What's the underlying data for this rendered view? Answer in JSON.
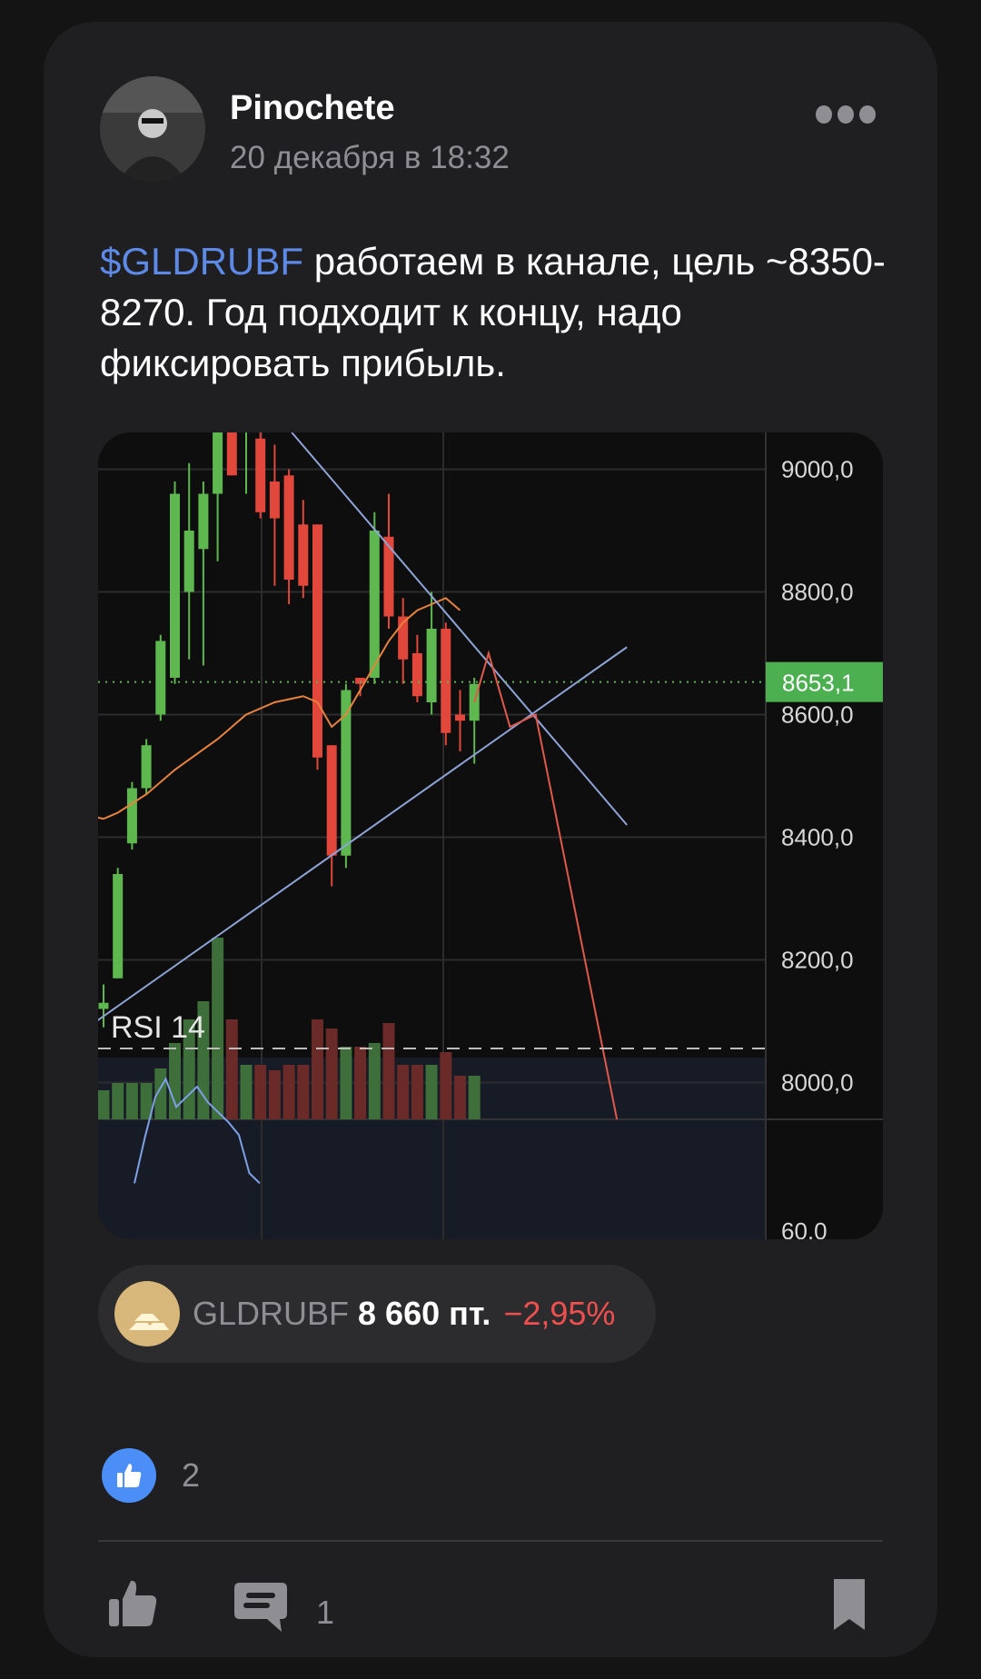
{
  "post": {
    "author": "Pinochete",
    "date": "20 декабря в 18:32",
    "ticker_link": "$GLDRUBF",
    "text": " работаем в канале, цель ~8350-8270. Год подходит к концу, надо фиксировать прибыль."
  },
  "chart_data": {
    "type": "candlestick",
    "price_axis_labels": [
      "9000,0",
      "8800,0",
      "8600,0",
      "8400,0",
      "8200,0",
      "8000,0"
    ],
    "current_price_label": "8653,1",
    "indicator_label": "RSI 14",
    "indicator_axis_label": "60,0",
    "ylim": [
      7940,
      9060
    ],
    "candles": [
      {
        "o": 8120,
        "h": 8160,
        "l": 8090,
        "c": 8130
      },
      {
        "o": 8170,
        "h": 8350,
        "l": 8170,
        "c": 8340
      },
      {
        "o": 8390,
        "h": 8490,
        "l": 8380,
        "c": 8480
      },
      {
        "o": 8480,
        "h": 8560,
        "l": 8470,
        "c": 8550
      },
      {
        "o": 8600,
        "h": 8730,
        "l": 8590,
        "c": 8720
      },
      {
        "o": 8660,
        "h": 8980,
        "l": 8650,
        "c": 8960
      },
      {
        "o": 8800,
        "h": 9010,
        "l": 8690,
        "c": 8900
      },
      {
        "o": 8870,
        "h": 8980,
        "l": 8680,
        "c": 8960
      },
      {
        "o": 8960,
        "h": 9080,
        "l": 8850,
        "c": 9060
      },
      {
        "o": 9060,
        "h": 9120,
        "l": 8990,
        "c": 8990
      },
      {
        "o": 9060,
        "h": 9110,
        "l": 8960,
        "c": 9070
      },
      {
        "o": 9050,
        "h": 9080,
        "l": 8920,
        "c": 8930
      },
      {
        "o": 8980,
        "h": 9040,
        "l": 8810,
        "c": 8920
      },
      {
        "o": 8990,
        "h": 9000,
        "l": 8780,
        "c": 8820
      },
      {
        "o": 8910,
        "h": 8950,
        "l": 8790,
        "c": 8810
      },
      {
        "o": 8910,
        "h": 8910,
        "l": 8510,
        "c": 8530
      },
      {
        "o": 8550,
        "h": 8550,
        "l": 8320,
        "c": 8370
      },
      {
        "o": 8370,
        "h": 8650,
        "l": 8350,
        "c": 8640
      },
      {
        "o": 8660,
        "h": 8660,
        "l": 8630,
        "c": 8650
      },
      {
        "o": 8660,
        "h": 8930,
        "l": 8650,
        "c": 8900
      },
      {
        "o": 8890,
        "h": 8960,
        "l": 8740,
        "c": 8760
      },
      {
        "o": 8760,
        "h": 8790,
        "l": 8650,
        "c": 8690
      },
      {
        "o": 8700,
        "h": 8730,
        "l": 8620,
        "c": 8630
      },
      {
        "o": 8620,
        "h": 8800,
        "l": 8600,
        "c": 8740
      },
      {
        "o": 8740,
        "h": 8750,
        "l": 8550,
        "c": 8570
      },
      {
        "o": 8600,
        "h": 8640,
        "l": 8540,
        "c": 8590
      },
      {
        "o": 8590,
        "h": 8660,
        "l": 8520,
        "c": 8650
      }
    ],
    "volumes": [
      0.16,
      0.2,
      0.2,
      0.2,
      0.28,
      0.42,
      0.55,
      0.65,
      1.0,
      0.55,
      0.3,
      0.3,
      0.27,
      0.3,
      0.3,
      0.55,
      0.5,
      0.4,
      0.4,
      0.42,
      0.53,
      0.3,
      0.3,
      0.3,
      0.37,
      0.24,
      0.24
    ],
    "moving_average": [
      [
        -2,
        8440
      ],
      [
        0,
        8430
      ],
      [
        1,
        8440
      ],
      [
        3,
        8470
      ],
      [
        5,
        8510
      ],
      [
        8,
        8560
      ],
      [
        10,
        8600
      ],
      [
        12,
        8620
      ],
      [
        14,
        8630
      ],
      [
        15,
        8620
      ],
      [
        16,
        8580
      ],
      [
        17,
        8600
      ],
      [
        18,
        8640
      ],
      [
        19,
        8680
      ],
      [
        20,
        8720
      ],
      [
        21,
        8750
      ],
      [
        22,
        8770
      ],
      [
        23,
        8780
      ],
      [
        24,
        8790
      ],
      [
        25,
        8770
      ]
    ],
    "trend_lines": [
      {
        "from": [
          13.2,
          9060
        ],
        "to": [
          36.7,
          8420
        ]
      },
      {
        "from": [
          -0.5,
          8100
        ],
        "to": [
          36.7,
          8710
        ]
      }
    ],
    "forecast_path": [
      [
        26,
        8620
      ],
      [
        27,
        8700
      ],
      [
        28.5,
        8580
      ],
      [
        30.3,
        8600
      ],
      [
        36,
        7940
      ]
    ],
    "rsi_values": [
      22,
      40,
      56,
      63,
      52,
      56,
      60,
      54,
      50,
      46,
      41,
      26,
      22
    ]
  },
  "instrument": {
    "ticker": "GLDRUBF",
    "price": "8 660 пт.",
    "change": "−2,95%"
  },
  "reactions": {
    "count": "2"
  },
  "actions": {
    "comments_count": "1"
  },
  "colors": {
    "accent_blue": "#5d8ae6",
    "up": "#5fb84f",
    "down": "#e2473b",
    "negative_text": "#ef4f4f",
    "price_tag": "#4caf50"
  }
}
